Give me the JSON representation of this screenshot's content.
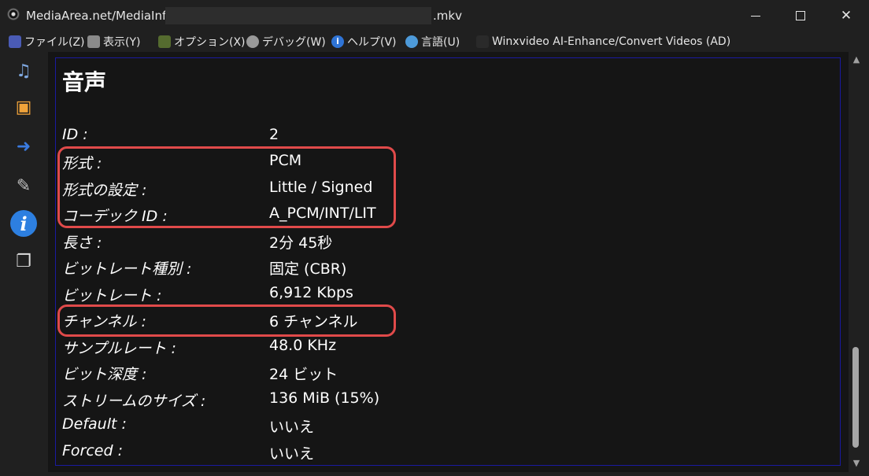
{
  "window": {
    "title_prefix": "MediaArea.net/MediaInfo -",
    "title_suffix": ".mkv",
    "controls": {
      "minimize_icon": "minimize-icon",
      "maximize_icon": "maximize-icon",
      "close_icon": "close-icon",
      "close_glyph": "✕"
    }
  },
  "menu": {
    "file": "ファイル(Z)",
    "view": "表示(Y)",
    "options": "オプション(X)",
    "debug": "デバッグ(W)",
    "help": "ヘルプ(V)",
    "help_glyph": "i",
    "language": "言語(U)",
    "ad": "Winxvideo AI-Enhance/Convert Videos (AD)"
  },
  "toolbar": {
    "open_file_icon": "music-file-search-icon",
    "open_folder_icon": "folder-search-icon",
    "export_icon": "export-info-icon",
    "preferences_icon": "wrench-icon",
    "about_glyph": "i",
    "sheets_icon": "sheets-web-icon"
  },
  "section": {
    "title": "音声",
    "rows": [
      {
        "label": "ID :",
        "value": "2"
      },
      {
        "label": "形式 :",
        "value": "PCM"
      },
      {
        "label": "形式の設定 :",
        "value": "Little / Signed"
      },
      {
        "label": "コーデック ID :",
        "value": "A_PCM/INT/LIT"
      },
      {
        "label": "長さ :",
        "value": "2分 45秒"
      },
      {
        "label": "ビットレート種別 :",
        "value": "固定 (CBR)"
      },
      {
        "label": "ビットレート :",
        "value": "6,912 Kbps"
      },
      {
        "label": "チャンネル :",
        "value": "6 チャンネル"
      },
      {
        "label": "サンプルレート :",
        "value": "48.0 KHz"
      },
      {
        "label": "ビット深度 :",
        "value": "24 ビット"
      },
      {
        "label": "ストリームのサイズ :",
        "value": "136 MiB (15%)"
      },
      {
        "label": "Default :",
        "value": "いいえ"
      },
      {
        "label": "Forced :",
        "value": "いいえ"
      }
    ]
  },
  "scrollbar": {
    "up_glyph": "▲",
    "down_glyph": "▼"
  },
  "colors": {
    "highlight": "#e04a4a",
    "background": "#151515",
    "border": "#1a1aa0"
  }
}
